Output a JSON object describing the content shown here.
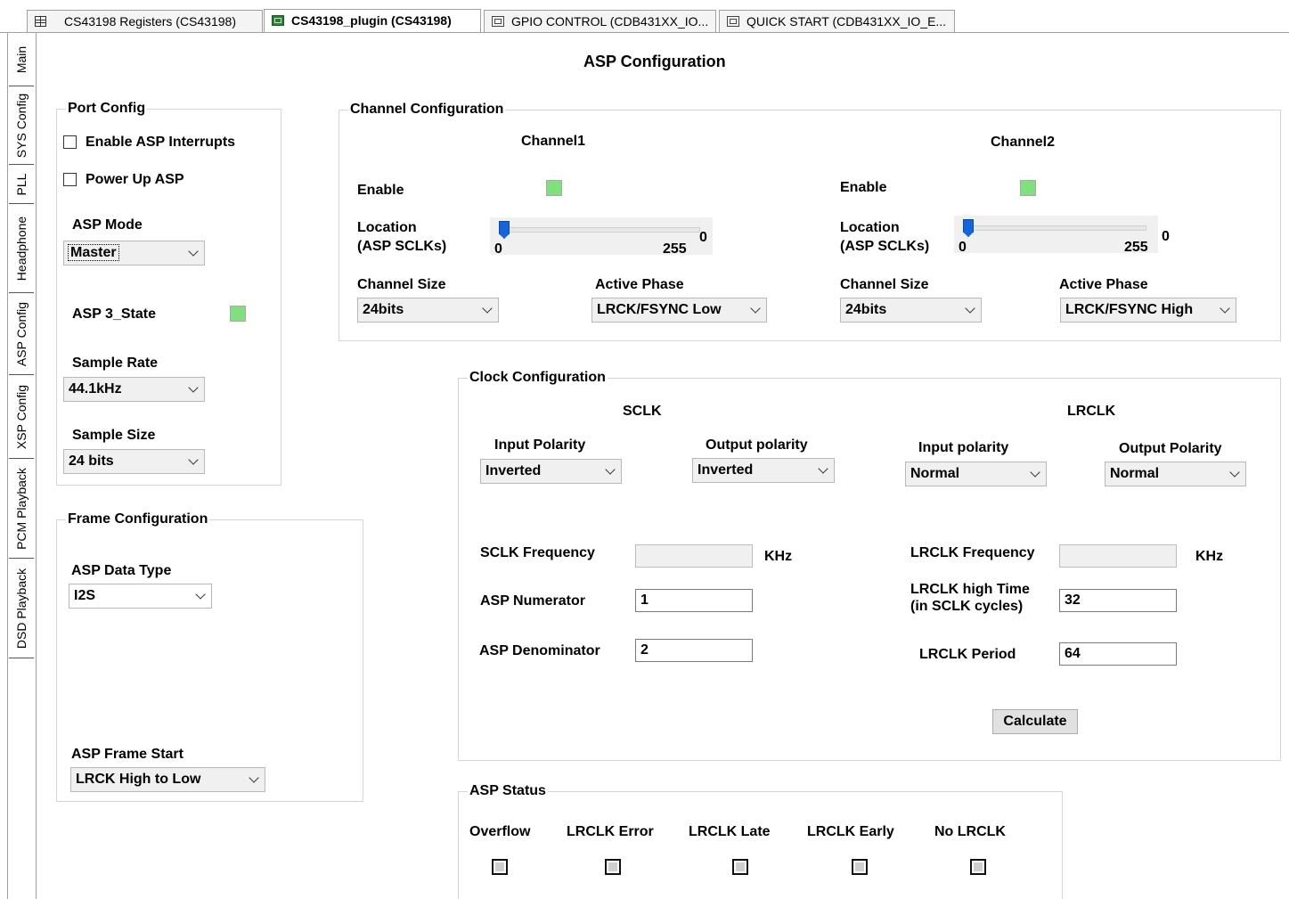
{
  "tabs": [
    {
      "label": "CS43198 Registers (CS43198)",
      "active": false
    },
    {
      "label": "CS43198_plugin (CS43198)",
      "active": true
    },
    {
      "label": "GPIO CONTROL (CDB431XX_IO...",
      "active": false
    },
    {
      "label": "QUICK START (CDB431XX_IO_E...",
      "active": false
    }
  ],
  "side_tabs": [
    "Main",
    "SYS Config",
    "PLL",
    "Headphone",
    "ASP Config",
    "XSP Config",
    "PCM Playback",
    "DSD Playback"
  ],
  "page_title": "ASP Configuration",
  "port_config": {
    "title": "Port Config",
    "enable_interrupts": "Enable ASP Interrupts",
    "power_up": "Power Up ASP",
    "asp_mode_label": "ASP Mode",
    "asp_mode_value": "Master",
    "three_state_label": "ASP 3_State",
    "sample_rate_label": "Sample Rate",
    "sample_rate_value": "44.1kHz",
    "sample_size_label": "Sample Size",
    "sample_size_value": "24 bits"
  },
  "frame_config": {
    "title": "Frame Configuration",
    "data_type_label": "ASP Data Type",
    "data_type_value": "I2S",
    "frame_start_label": "ASP Frame Start",
    "frame_start_value": "LRCK High to Low"
  },
  "channel_config": {
    "title": "Channel Configuration",
    "channel1": {
      "title": "Channel1",
      "enable_label": "Enable",
      "location_label_1": "Location",
      "location_label_2": "(ASP SCLKs)",
      "slider_min": "0",
      "slider_max": "255",
      "slider_value": "0",
      "size_label": "Channel Size",
      "size_value": "24bits",
      "phase_label": "Active Phase",
      "phase_value": "LRCK/FSYNC Low"
    },
    "channel2": {
      "title": "Channel2",
      "enable_label": "Enable",
      "location_label_1": "Location",
      "location_label_2": "(ASP SCLKs)",
      "slider_min": "0",
      "slider_max": "255",
      "slider_value": "0",
      "size_label": "Channel Size",
      "size_value": "24bits",
      "phase_label": "Active Phase",
      "phase_value": "LRCK/FSYNC High"
    }
  },
  "clock_config": {
    "title": "Clock Configuration",
    "sclk_title": "SCLK",
    "lrclk_title": "LRCLK",
    "sclk_in_pol_label": "Input Polarity",
    "sclk_in_pol_value": "Inverted",
    "sclk_out_pol_label": "Output polarity",
    "sclk_out_pol_value": "Inverted",
    "lrclk_in_pol_label": "Input polarity",
    "lrclk_in_pol_value": "Normal",
    "lrclk_out_pol_label": "Output Polarity",
    "lrclk_out_pol_value": "Normal",
    "sclk_freq_label": "SCLK Frequency",
    "sclk_freq_value": "",
    "sclk_freq_unit": "KHz",
    "lrclk_freq_label": "LRCLK Frequency",
    "lrclk_freq_value": "",
    "lrclk_freq_unit": "KHz",
    "numerator_label": "ASP Numerator",
    "numerator_value": "1",
    "denominator_label": "ASP Denominator",
    "denominator_value": "2",
    "high_time_label_1": "LRCLK high Time",
    "high_time_label_2": "(in SCLK cycles)",
    "high_time_value": "32",
    "period_label": "LRCLK Period",
    "period_value": "64",
    "calculate_label": "Calculate"
  },
  "asp_status": {
    "title": "ASP Status",
    "indicators": [
      "Overflow",
      "LRCLK Error",
      "LRCLK Late",
      "LRCLK Early",
      "No LRCLK"
    ]
  },
  "colors": {
    "led_on": "#80e080",
    "slider_thumb": "#1565d8"
  }
}
